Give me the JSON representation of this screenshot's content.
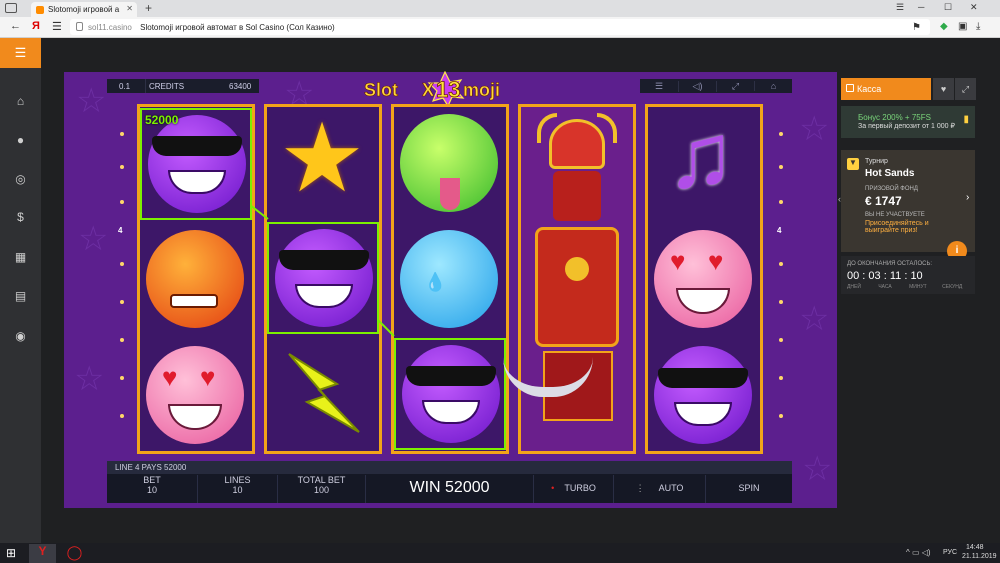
{
  "browser": {
    "tab_title": "Slotomoji игровой а",
    "url_domain": "sol11.casino",
    "url_title": "Slotomoji игровой автомат в Sol Casino (Сол Казино)"
  },
  "game": {
    "line_bet": "0.1",
    "credits_label": "CREDITS",
    "credits_value": "63400",
    "logo_text": "SlotX13moji",
    "logo_parts": [
      "Slot",
      "X",
      "13",
      "moji"
    ],
    "win_badge": "52000",
    "line_left": "4",
    "line_right": "4",
    "pays_text": "LINE 4 PAYS 52000",
    "bet_label": "BET",
    "bet_value": "10",
    "lines_label": "LINES",
    "lines_value": "10",
    "total_label": "TOTAL BET",
    "total_value": "100",
    "win_text": "WIN 52000",
    "turbo_label": "TURBO",
    "auto_label": "AUTO",
    "spin_label": "SPIN"
  },
  "side": {
    "kassa_label": "Касса",
    "bonus_title": "Бонус 200% + 75FS",
    "bonus_sub": "За первый депозит от 1 000 ₽",
    "tourn_label": "Турнир",
    "tourn_name": "Hot Sands",
    "prize_label": "ПРИЗОВОЙ ФОНД",
    "prize_value": "€ 1747",
    "not_joined": "ВЫ НЕ УЧАСТВУЕТЕ",
    "join_text": "Присоединяйтесь и выиграйте приз!",
    "ends_label": "ДО ОКОНЧАНИЯ ОСТАЛОСЬ:",
    "days": "00",
    "hours": "03",
    "mins": "11",
    "secs": "10",
    "days_l": "ДНЕЙ",
    "hours_l": "ЧАСА",
    "mins_l": "МИНУТ",
    "secs_l": "СЕКУНД",
    "info_icon": "i"
  },
  "taskbar": {
    "lang": "РУС",
    "time": "14:48",
    "date": "21.11.2019"
  },
  "colors": {
    "accent": "#f18a1c",
    "reel_border": "#f2a41a",
    "highlight": "#7cf000",
    "game_bg": "#5c1f8e"
  }
}
